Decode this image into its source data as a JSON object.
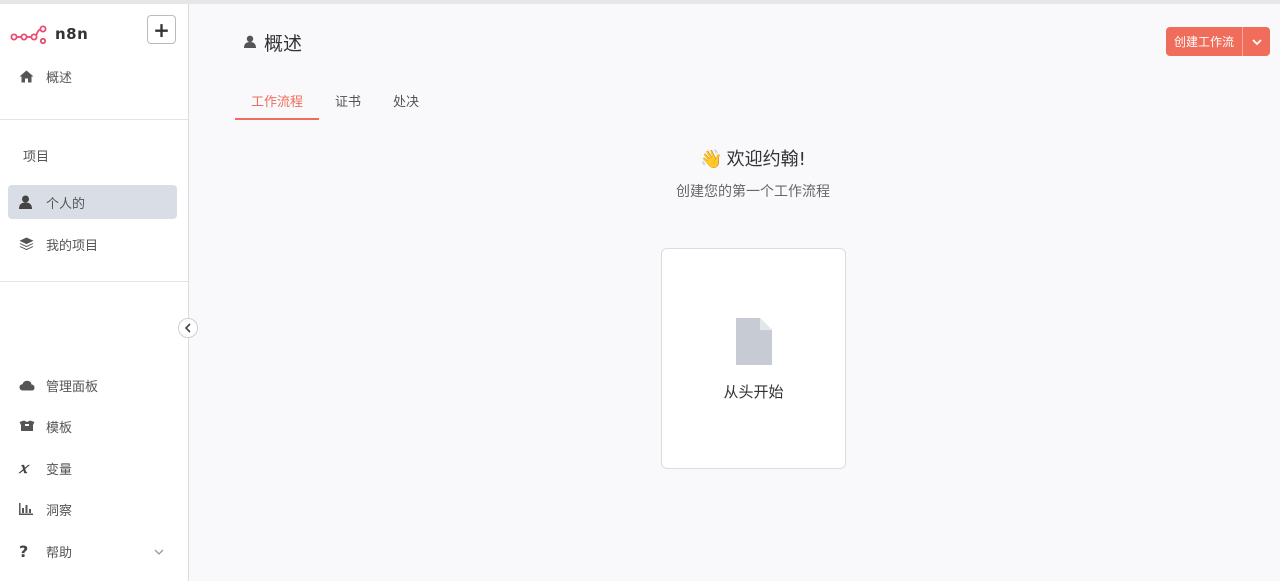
{
  "app": {
    "name": "n8n",
    "brand_color": "#ea4b71",
    "accent": "#ef6d5a"
  },
  "sidebar": {
    "add_button": "+",
    "overview": {
      "label": "概述",
      "icon": "home-icon"
    },
    "projects_title": "项目",
    "projects": [
      {
        "label": "个人的",
        "icon": "user-icon",
        "active": true
      },
      {
        "label": "我的项目",
        "icon": "layers-icon",
        "active": false
      }
    ],
    "bottom": [
      {
        "label": "管理面板",
        "icon": "cloud-icon"
      },
      {
        "label": "模板",
        "icon": "box-icon"
      },
      {
        "label": "变量",
        "icon": "variable-icon"
      },
      {
        "label": "洞察",
        "icon": "chart-icon"
      },
      {
        "label": "帮助",
        "icon": "question-icon"
      }
    ]
  },
  "header": {
    "title": "概述",
    "create_button": "创建工作流"
  },
  "tabs": [
    {
      "label": "工作流程",
      "active": true
    },
    {
      "label": "证书",
      "active": false
    },
    {
      "label": "处决",
      "active": false
    }
  ],
  "main": {
    "welcome_emoji": "👋",
    "welcome": "欢迎约翰!",
    "subtitle": "创建您的第一个工作流程",
    "start_card": "从头开始"
  }
}
